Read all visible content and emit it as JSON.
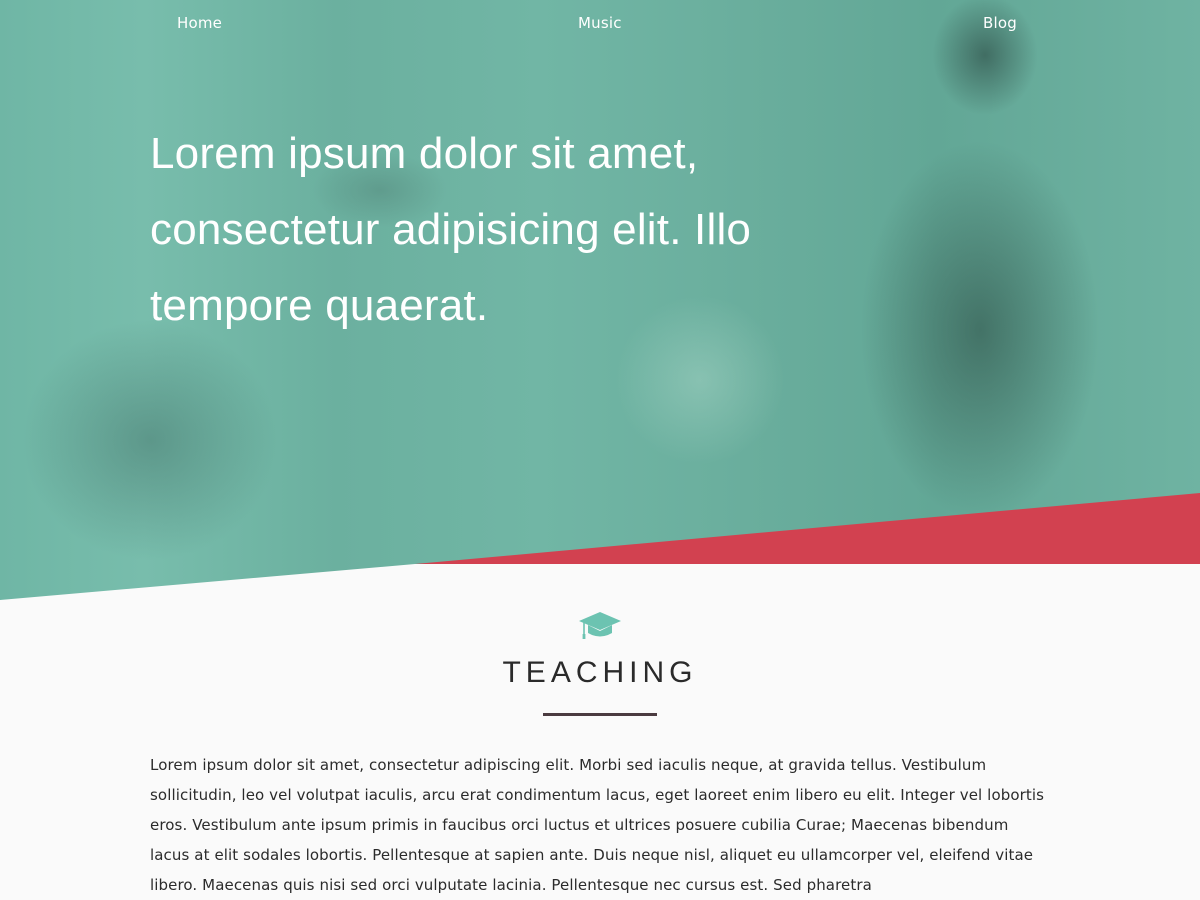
{
  "nav": {
    "items": [
      {
        "label": "Home"
      },
      {
        "label": "Music"
      },
      {
        "label": "Blog"
      }
    ]
  },
  "hero": {
    "headline": "Lorem ipsum dolor sit amet, consectetur adipisicing elit. Illo tempore quaerat."
  },
  "teaching": {
    "icon": "graduation-cap-icon",
    "title": "TEACHING",
    "body": "Lorem ipsum dolor sit amet, consectetur adipiscing elit. Morbi sed iaculis neque, at gravida tellus. Vestibulum sollicitudin, leo vel volutpat iaculis, arcu erat condimentum lacus, eget laoreet enim libero eu elit. Integer vel lobortis eros. Vestibulum ante ipsum primis in faucibus orci luctus et ultrices posuere cubilia Curae; Maecenas bibendum lacus at elit sodales lobortis. Pellentesque at sapien ante. Duis neque nisl, aliquet eu ullamcorper vel, eleifend vitae libero. Maecenas quis nisi sed orci vulputate lacinia. Pellentesque nec cursus est. Sed pharetra"
  },
  "colors": {
    "hero_overlay": "#6fb5a4",
    "accent_red": "#d24150",
    "icon_teal": "#6cc3b1",
    "divider": "#4a3b40",
    "background": "#fafafa"
  }
}
